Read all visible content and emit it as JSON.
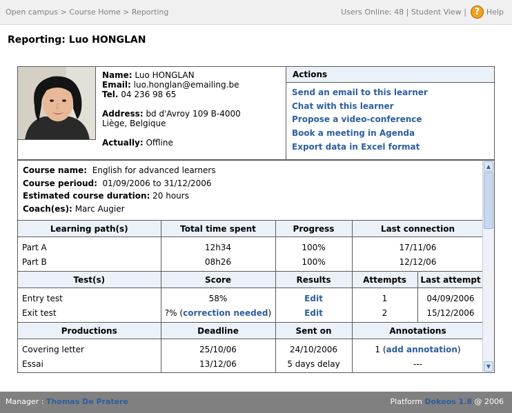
{
  "breadcrumb": {
    "items": [
      "Open campus",
      "Course Home",
      "Reporting"
    ],
    "separator": ">"
  },
  "topbar": {
    "users_online": "Users Online: 48",
    "student_view": "Student View",
    "help": "Help",
    "separator": "|"
  },
  "page_title": "Reporting: Luo HONGLAN",
  "profile": {
    "name_label": "Name:",
    "name": "Luo HONGLAN",
    "email_label": "Email:",
    "email": "luo.honglan@emailing.be",
    "tel_label": "Tel.",
    "tel": "04 236 98 65",
    "address_label": "Address:",
    "address_line1": "bd d'Avroy 109 B-4000",
    "address_line2": "Liège, Belgique",
    "actually_label": "Actually:",
    "actually": "Offline"
  },
  "actions": {
    "title": "Actions",
    "items": [
      "Send an email to this learner",
      "Chat with this learner",
      "Propose a video-conference",
      "Book a meeting in Agenda",
      "Export data in Excel format"
    ]
  },
  "course": {
    "name_label": "Course name:",
    "name": "English for advanced learners",
    "period_label": "Course perioud:",
    "period": "01/09/2006 to 31/12/2006",
    "duration_label": "Estimated course duration:",
    "duration": "20 hours",
    "coach_label": "Coach(es):",
    "coach": "Marc Augier"
  },
  "learning_paths": {
    "headers": [
      "Learning path(s)",
      "Total time spent",
      "Progress",
      "Last connection"
    ],
    "rows": [
      [
        "Part A",
        "12h34",
        "100%",
        "17/11/06"
      ],
      [
        "Part B",
        "08h26",
        "100%",
        "12/12/06"
      ]
    ]
  },
  "tests": {
    "headers": [
      "Test(s)",
      "Score",
      "Results",
      "Attempts",
      "Last attempt"
    ],
    "rows": [
      {
        "name": "Entry test",
        "score": "58%",
        "score_link": "",
        "results": "Edit",
        "attempts": "1",
        "last": "04/09/2006"
      },
      {
        "name": "Exit test",
        "score": "?% (",
        "score_link": "correction needed",
        "score_end": ")",
        "results": "Edit",
        "attempts": "2",
        "last": "15/12/2006"
      }
    ]
  },
  "productions": {
    "headers": [
      "Productions",
      "Deadline",
      "Sent on",
      "Annotations"
    ],
    "rows": [
      {
        "name": "Covering letter",
        "deadline": "25/10/06",
        "sent": "24/10/2006",
        "ann_pre": "1 (",
        "ann_link": "add annotation",
        "ann_post": ")"
      },
      {
        "name": "Essai",
        "deadline": "13/12/06",
        "sent": "5 days delay",
        "ann_pre": "---",
        "ann_link": "",
        "ann_post": ""
      }
    ]
  },
  "footer": {
    "manager_label": "Manager :",
    "manager": "Thomas De Pratere",
    "platform_label": "Platform",
    "platform": "Dokeos 1.8",
    "year": "@ 2006"
  },
  "colors": {
    "link": "#2c5e9e",
    "header_bg": "#eaf1f9",
    "footer_bg": "#808080",
    "topbar_bg": "#f0f0f0"
  }
}
